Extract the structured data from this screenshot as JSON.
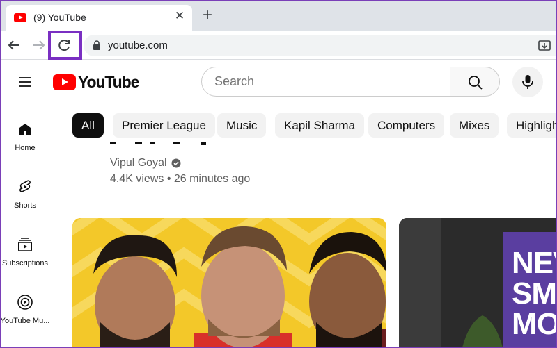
{
  "browser": {
    "tab_title": "(9) YouTube",
    "url": "youtube.com"
  },
  "youtube": {
    "logo_text": "YouTube",
    "search_placeholder": "Search",
    "chips": [
      "All",
      "Premier League",
      "Music",
      "Kapil Sharma",
      "Computers",
      "Mixes",
      "Highligh"
    ],
    "sidebar": [
      {
        "label": "Home",
        "icon": "home-icon"
      },
      {
        "label": "Shorts",
        "icon": "shorts-icon"
      },
      {
        "label": "Subscriptions",
        "icon": "subscriptions-icon"
      },
      {
        "label": "YouTube Mu...",
        "icon": "youtube-music-icon"
      }
    ],
    "video": {
      "channel": "Vipul Goyal",
      "stats": "4.4K views • 26 minutes ago"
    },
    "second_thumb_text": [
      "NEV",
      "SMA",
      "MO"
    ]
  },
  "colors": {
    "highlight": "#7a2fc2",
    "brand_red": "#ff0000",
    "chip_active": "#0f0f0f",
    "chip_bg": "#f2f2f2"
  }
}
